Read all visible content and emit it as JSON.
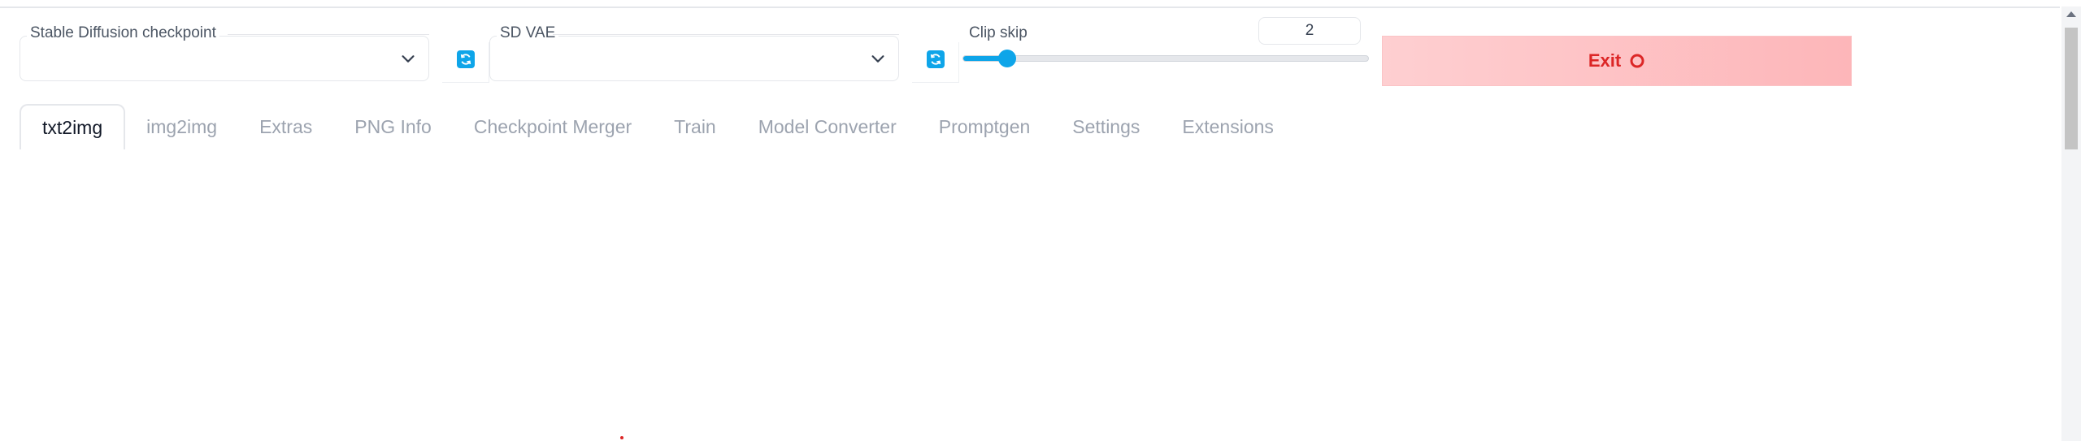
{
  "checkpoint": {
    "label": "Stable Diffusion checkpoint",
    "value": ""
  },
  "vae": {
    "label": "SD VAE",
    "value": ""
  },
  "clip_skip": {
    "label": "Clip skip",
    "value": "2",
    "slider_fraction": 0.11
  },
  "exit_button": {
    "label": "Exit"
  },
  "tabs": [
    {
      "label": "txt2img",
      "active": true
    },
    {
      "label": "img2img",
      "active": false
    },
    {
      "label": "Extras",
      "active": false
    },
    {
      "label": "PNG Info",
      "active": false
    },
    {
      "label": "Checkpoint Merger",
      "active": false
    },
    {
      "label": "Train",
      "active": false
    },
    {
      "label": "Model Converter",
      "active": false
    },
    {
      "label": "Promptgen",
      "active": false
    },
    {
      "label": "Settings",
      "active": false
    },
    {
      "label": "Extensions",
      "active": false
    }
  ],
  "colors": {
    "accent": "#0ea5e9",
    "exit_text": "#dc2626",
    "exit_bg": "#fdb6b9"
  }
}
